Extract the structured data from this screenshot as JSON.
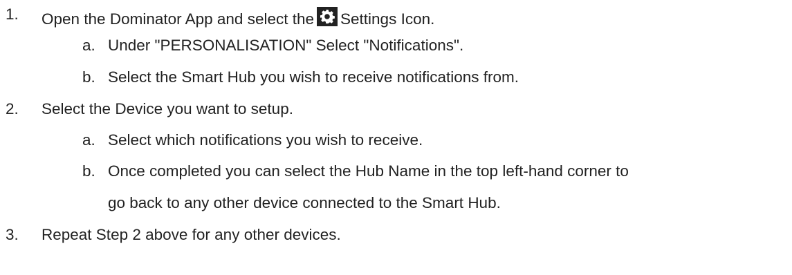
{
  "steps": [
    {
      "num": "1.",
      "text_before_icon": "Open the Dominator App and select the",
      "icon": "settings-gear-icon",
      "text_after_icon": "Settings Icon.",
      "substeps": [
        {
          "letter": "a.",
          "text": "Under \"PERSONALISATION\" Select \"Notifications\"."
        },
        {
          "letter": "b.",
          "text": "Select the Smart Hub you wish to receive notifications from."
        }
      ]
    },
    {
      "num": "2.",
      "text": "Select the Device you want to setup.",
      "substeps": [
        {
          "letter": "a.",
          "text": "Select which notifications you wish to receive."
        },
        {
          "letter": "b.",
          "text": "Once completed you can select the Hub Name in the top left-hand corner to",
          "text_cont": "go back to any other device connected to the Smart Hub."
        }
      ]
    },
    {
      "num": "3.",
      "text": "Repeat Step 2 above for any other devices."
    }
  ]
}
